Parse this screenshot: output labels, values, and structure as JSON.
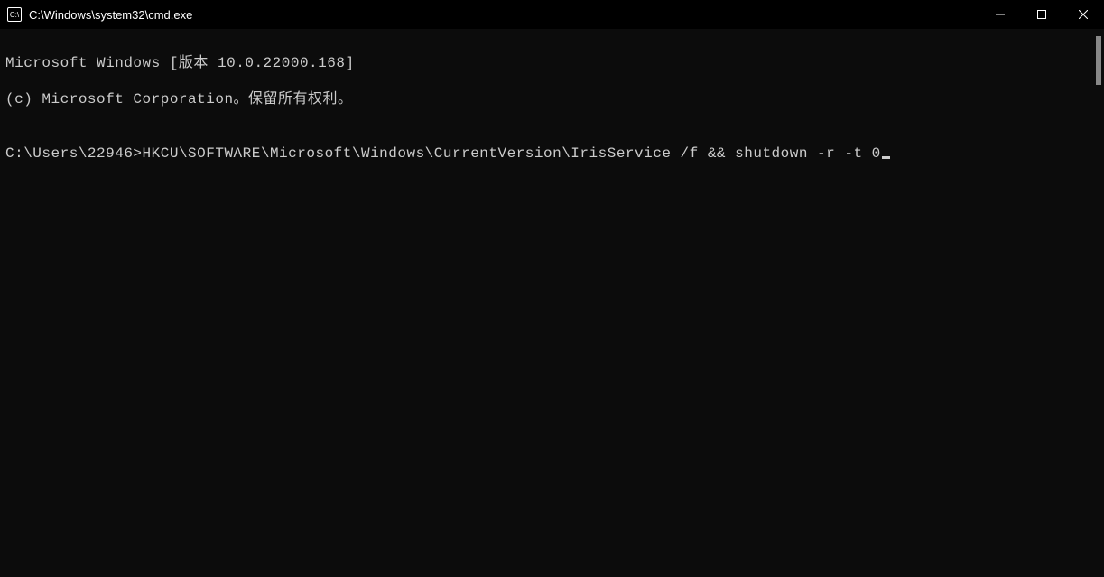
{
  "title": "C:\\Windows\\system32\\cmd.exe",
  "terminal": {
    "line1": "Microsoft Windows [版本 10.0.22000.168]",
    "line2": "(c) Microsoft Corporation。保留所有权利。",
    "blank": "",
    "prompt": "C:\\Users\\22946>",
    "command": "HKCU\\SOFTWARE\\Microsoft\\Windows\\CurrentVersion\\IrisService /f && shutdown -r -t 0"
  }
}
